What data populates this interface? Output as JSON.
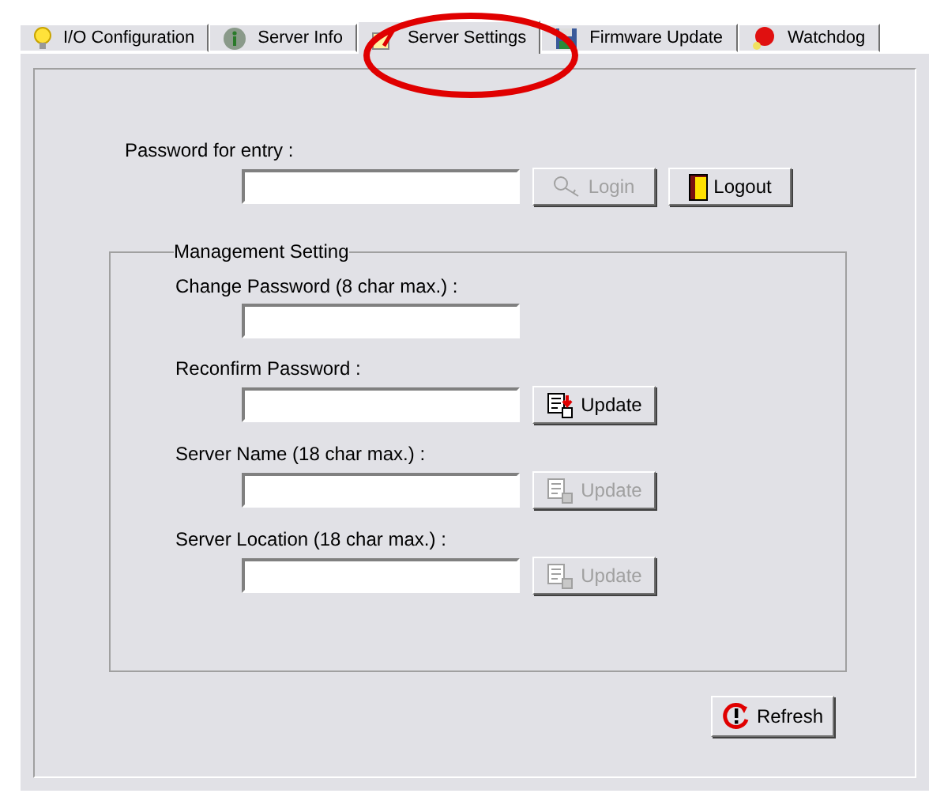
{
  "tabs": [
    {
      "label": "I/O Configuration",
      "selected": false
    },
    {
      "label": "Server Info",
      "selected": false
    },
    {
      "label": "Server Settings",
      "selected": true
    },
    {
      "label": "Firmware Update",
      "selected": false
    },
    {
      "label": "Watchdog",
      "selected": false
    }
  ],
  "entry": {
    "label": "Password for entry :",
    "buttons": [
      {
        "label": "Login",
        "kind": "login",
        "disabled": true
      },
      {
        "label": "Logout",
        "kind": "logout",
        "disabled": false
      }
    ]
  },
  "management": {
    "title": "Management Setting",
    "fields": [
      {
        "label": "Change Password (8 char max.) :"
      },
      {
        "label": "Reconfirm Password :",
        "button": {
          "label": "Update",
          "disabled": false
        }
      },
      {
        "label": "Server Name (18 char max.) :",
        "button": {
          "label": "Update",
          "disabled": true
        }
      },
      {
        "label": "Server Location (18 char max.) :",
        "button": {
          "label": "Update",
          "disabled": true
        }
      }
    ]
  },
  "refresh": {
    "label": "Refresh"
  }
}
